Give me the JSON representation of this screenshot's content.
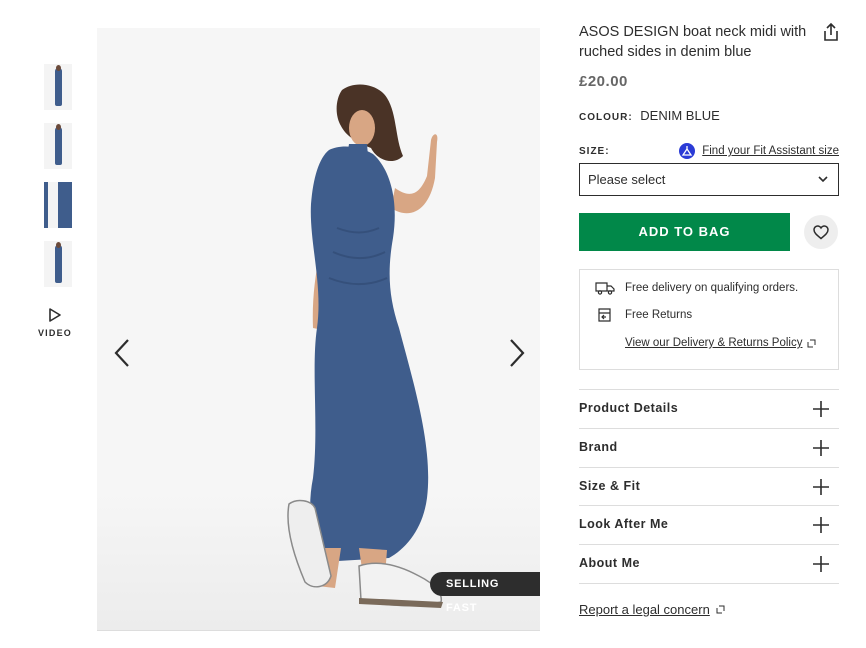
{
  "gallery": {
    "thumbnails": [
      "thumb-1",
      "thumb-2",
      "thumb-3",
      "thumb-4"
    ],
    "video_label": "VIDEO",
    "badge": "SELLING FAST"
  },
  "product": {
    "title": "ASOS DESIGN boat neck midi with ruched sides in denim blue",
    "price": "£20.00",
    "colour_label": "COLOUR:",
    "colour_value": "DENIM BLUE",
    "size_label": "SIZE:",
    "fit_assistant": "Find your Fit Assistant size",
    "size_select": "Please select",
    "add_to_bag": "ADD TO BAG"
  },
  "delivery": {
    "free_delivery": "Free delivery on qualifying orders.",
    "free_returns": "Free Returns",
    "policy_link": "View our Delivery & Returns Policy"
  },
  "accordion": [
    {
      "label": "Product Details"
    },
    {
      "label": "Brand"
    },
    {
      "label": "Size & Fit"
    },
    {
      "label": "Look After Me"
    },
    {
      "label": "About Me"
    }
  ],
  "legal_link": "Report a legal concern",
  "colors": {
    "accent_green": "#018849",
    "text": "#2d2d2d",
    "fit_icon_blue": "#2b3bd6",
    "dress_blue": "#3f5d8c"
  }
}
